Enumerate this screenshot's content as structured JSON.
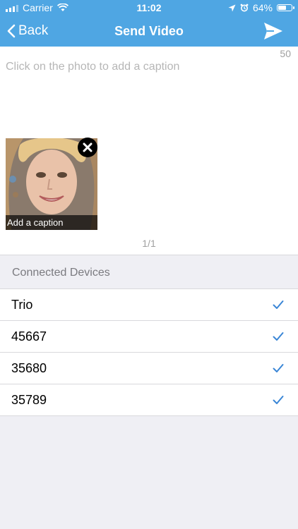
{
  "status": {
    "carrier": "Carrier",
    "time": "11:02",
    "battery": "64%",
    "battery_level": 0.64
  },
  "nav": {
    "back_label": "Back",
    "title": "Send Video"
  },
  "compose": {
    "char_counter": "50",
    "caption_placeholder": "Click on the photo to add a caption",
    "thumbnail_caption": "Add a caption",
    "pager": "1/1"
  },
  "devices": {
    "header": "Connected Devices",
    "items": [
      {
        "label": "Trio",
        "checked": true
      },
      {
        "label": "45667",
        "checked": true
      },
      {
        "label": "35680",
        "checked": true
      },
      {
        "label": "35789",
        "checked": true
      }
    ]
  },
  "colors": {
    "accent": "#4fa6e3",
    "check": "#3a86d6"
  }
}
